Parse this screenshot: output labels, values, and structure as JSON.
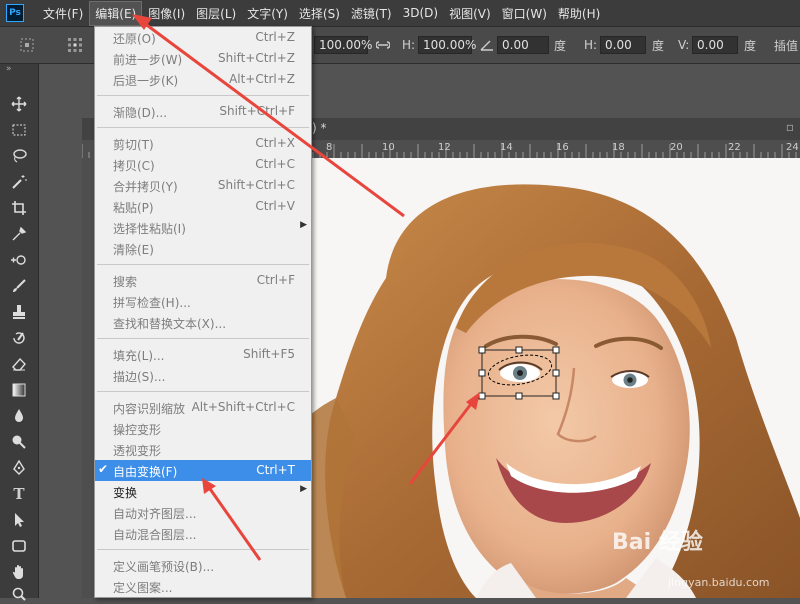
{
  "app": {
    "logo": "Ps"
  },
  "menubar": [
    {
      "label": "文件(F)"
    },
    {
      "label": "编辑(E)",
      "active": true
    },
    {
      "label": "图像(I)"
    },
    {
      "label": "图层(L)"
    },
    {
      "label": "文字(Y)"
    },
    {
      "label": "选择(S)"
    },
    {
      "label": "滤镜(T)"
    },
    {
      "label": "3D(D)"
    },
    {
      "label": "视图(V)"
    },
    {
      "label": "窗口(W)"
    },
    {
      "label": "帮助(H)"
    }
  ],
  "options": {
    "w_value": "100.00%",
    "h_label": "H:",
    "h_value": "100.00%",
    "angle_value": "0.00",
    "angle_unit": "度",
    "hskew_label": "H:",
    "hskew_value": "0.00",
    "hskew_unit": "度",
    "vskew_label": "V:",
    "vskew_value": "0.00",
    "vskew_unit": "度",
    "interp_label": "插值"
  },
  "document": {
    "tab_suffix": ") *"
  },
  "ruler_top": [
    "8",
    "10",
    "12",
    "14",
    "16",
    "18",
    "20",
    "22",
    "24"
  ],
  "edit_menu": [
    {
      "label": "还原(O)",
      "shortcut": "Ctrl+Z",
      "state": "disabled"
    },
    {
      "label": "前进一步(W)",
      "shortcut": "Shift+Ctrl+Z",
      "state": "disabled"
    },
    {
      "label": "后退一步(K)",
      "shortcut": "Alt+Ctrl+Z",
      "state": "disabled"
    },
    {
      "sep": true
    },
    {
      "label": "渐隐(D)...",
      "shortcut": "Shift+Ctrl+F",
      "state": "disabled"
    },
    {
      "sep": true
    },
    {
      "label": "剪切(T)",
      "shortcut": "Ctrl+X",
      "state": "disabled"
    },
    {
      "label": "拷贝(C)",
      "shortcut": "Ctrl+C",
      "state": "disabled"
    },
    {
      "label": "合并拷贝(Y)",
      "shortcut": "Shift+Ctrl+C",
      "state": "disabled"
    },
    {
      "label": "粘贴(P)",
      "shortcut": "Ctrl+V",
      "state": "disabled"
    },
    {
      "label": "选择性粘贴(I)",
      "shortcut": "",
      "state": "disabled",
      "submenu": true
    },
    {
      "label": "清除(E)",
      "shortcut": "",
      "state": "disabled"
    },
    {
      "sep": true
    },
    {
      "label": "搜索",
      "shortcut": "Ctrl+F",
      "state": "disabled"
    },
    {
      "label": "拼写检查(H)...",
      "shortcut": "",
      "state": "disabled"
    },
    {
      "label": "查找和替换文本(X)...",
      "shortcut": "",
      "state": "disabled"
    },
    {
      "sep": true
    },
    {
      "label": "填充(L)...",
      "shortcut": "Shift+F5",
      "state": "disabled"
    },
    {
      "label": "描边(S)...",
      "shortcut": "",
      "state": "disabled"
    },
    {
      "sep": true
    },
    {
      "label": "内容识别缩放",
      "shortcut": "Alt+Shift+Ctrl+C",
      "state": "disabled"
    },
    {
      "label": "操控变形",
      "shortcut": "",
      "state": "disabled"
    },
    {
      "label": "透视变形",
      "shortcut": "",
      "state": "disabled"
    },
    {
      "label": "自由变换(F)",
      "shortcut": "Ctrl+T",
      "state": "highlight",
      "checked": true
    },
    {
      "label": "变换",
      "shortcut": "",
      "state": "enabled",
      "submenu": true
    },
    {
      "label": "自动对齐图层...",
      "shortcut": "",
      "state": "disabled"
    },
    {
      "label": "自动混合图层...",
      "shortcut": "",
      "state": "disabled"
    },
    {
      "sep": true
    },
    {
      "label": "定义画笔预设(B)...",
      "shortcut": "",
      "state": "disabled"
    },
    {
      "label": "定义图案...",
      "shortcut": "",
      "state": "disabled"
    }
  ],
  "watermark": {
    "text": "Bai 经验",
    "url": "jingyan.baidu.com"
  },
  "colors": {
    "highlight": "#3d8ee8",
    "arrow": "#e8453c",
    "hair": "#b87a3c"
  }
}
